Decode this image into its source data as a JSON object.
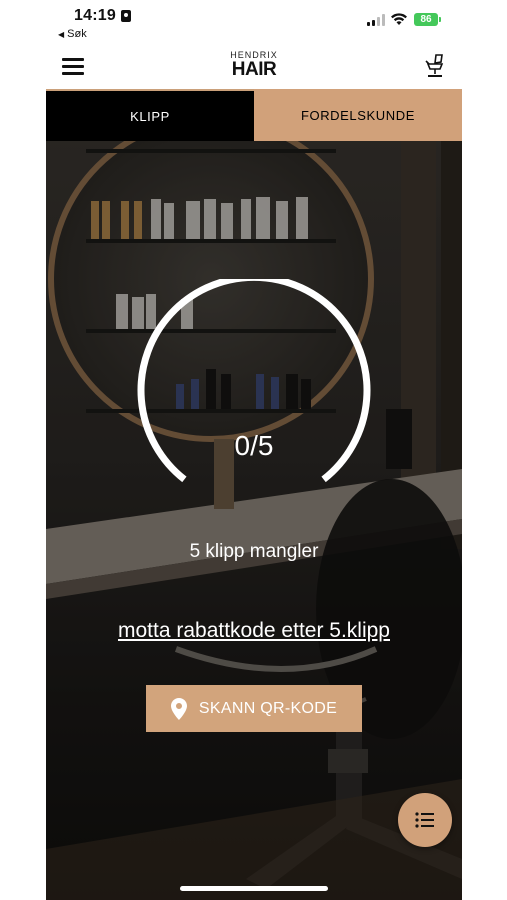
{
  "status_bar": {
    "time": "14:19",
    "back_label": "Søk",
    "battery": "86"
  },
  "header": {
    "logo_top": "HENDRIX",
    "logo_main": "HAIR"
  },
  "tabs": [
    {
      "label": "KLIPP",
      "active": false
    },
    {
      "label": "FORDELSKUNDE",
      "active": true
    }
  ],
  "loyalty": {
    "progress_text": "0/5",
    "progress_fraction": 0,
    "remaining_text": "5 klipp mangler",
    "promo_link": "motta rabattkode etter 5.klipp",
    "scan_button_label": "SKANN QR-KODE"
  },
  "colors": {
    "accent": "#d1a17a",
    "tab_inactive": "#000000",
    "text_on_dark": "#ffffff"
  },
  "icons": {
    "menu": "hamburger-menu-icon",
    "booking": "barber-chair-icon",
    "location": "location-pin-icon",
    "list": "list-icon"
  }
}
